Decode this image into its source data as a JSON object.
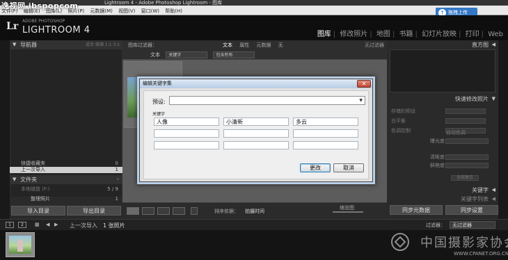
{
  "window": {
    "title": "Lightroom 4 - Adobe Photoshop Lightroom - 图库"
  },
  "watermark": {
    "top_left": "逸视网 ibspopcom",
    "bottom_right_cn": "中国摄影家协会",
    "bottom_right_url": "WWW.CPANET.ORG.CN"
  },
  "menubar": {
    "items": [
      "文件(F)",
      "编辑(E)",
      "图库(L)",
      "照片(P)",
      "元数据(M)",
      "视图(V)",
      "窗口(W)",
      "帮助(H)"
    ],
    "upload_label": "拖拽上传"
  },
  "header": {
    "logo": "Lr",
    "brand_small": "ADOBE PHOTOSHOP",
    "brand_big": "LIGHTROOM 4",
    "modules": [
      "图库",
      "修改照片",
      "地图",
      "书籍",
      "幻灯片放映",
      "打印",
      "Web"
    ]
  },
  "left_panel": {
    "navigator": {
      "title": "导航器",
      "zoom_options": "适合 填满 1:1 3:1"
    },
    "catalog_rows": [
      {
        "label": "快捷收藏夹",
        "count": "0"
      },
      {
        "label": "上一次导入",
        "count": "1"
      }
    ],
    "folders_title": "文件夹",
    "folder_rows": [
      {
        "label": "本地磁盘 (F:)",
        "count": "5 / 9"
      },
      {
        "label": "整理照片",
        "count": "1"
      }
    ],
    "import_button": "导入目录",
    "export_button": "导出目录"
  },
  "filter_bar": {
    "title": "图库过滤器：",
    "tabs": [
      "文本",
      "属性",
      "元数据",
      "无"
    ],
    "active_tab": "文本",
    "filter_label": "无过滤器",
    "row_label": "文本",
    "field1": "关键字",
    "field2": "包含所有"
  },
  "toolbar": {
    "sort_label": "排序依据：",
    "sort_value": "拍摄时间",
    "thumb_label": "缩览图"
  },
  "right_panel": {
    "histogram_title": "直方图",
    "quick_develop_title": "快速修改照片",
    "rows": [
      "存储的预设",
      "白平衡",
      "色调控制"
    ],
    "sub_rows": [
      "曝光度",
      "清晰度",
      "鲜艳度"
    ],
    "auto_tone": "自动色调",
    "reset": "全部复位",
    "keywords_title": "关键字",
    "keyword_list_title": "关键字列表",
    "sync_meta_button": "同步元数据",
    "sync_settings_button": "同步设置"
  },
  "filmstrip_bar": {
    "box1": "1",
    "box2": "2",
    "source": "上一次导入",
    "photo_count": "1 张照片",
    "filter_label": "过滤器：",
    "filter_value": "无过滤器"
  },
  "dialog": {
    "title": "编辑关键字集",
    "close_label": "✕",
    "preset_label": "预设:",
    "preset_value": "",
    "keywords_label": "关键字",
    "fields": [
      "人像",
      "小清新",
      "多云",
      "",
      "",
      "",
      "",
      "",
      ""
    ],
    "change_button": "更改",
    "cancel_button": "取消"
  }
}
